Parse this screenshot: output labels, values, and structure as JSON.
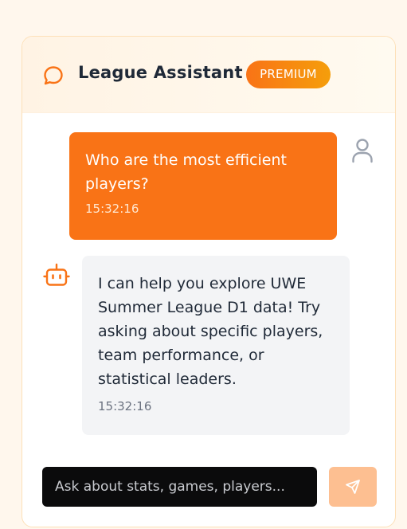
{
  "header": {
    "title": "League Assistant",
    "badge": "PREMIUM",
    "icon": "chat-bubble-icon"
  },
  "messages": [
    {
      "role": "user",
      "text": "Who are the most efficient players?",
      "time": "15:32:16",
      "avatar_icon": "user-icon"
    },
    {
      "role": "assistant",
      "text": "I can help you explore UWE Summer League D1 data! Try asking about specific players, team performance, or statistical leaders.",
      "time": "15:32:16",
      "avatar_icon": "bot-icon"
    }
  ],
  "composer": {
    "placeholder": "Ask about stats, games, players...",
    "value": "",
    "send_icon": "send-icon"
  },
  "colors": {
    "accent": "#f97316",
    "badge_end": "#f59e0b",
    "input_bg": "#0b0b0c",
    "send_disabled": "#fdbf91",
    "bot_bubble": "#f3f4f6"
  }
}
